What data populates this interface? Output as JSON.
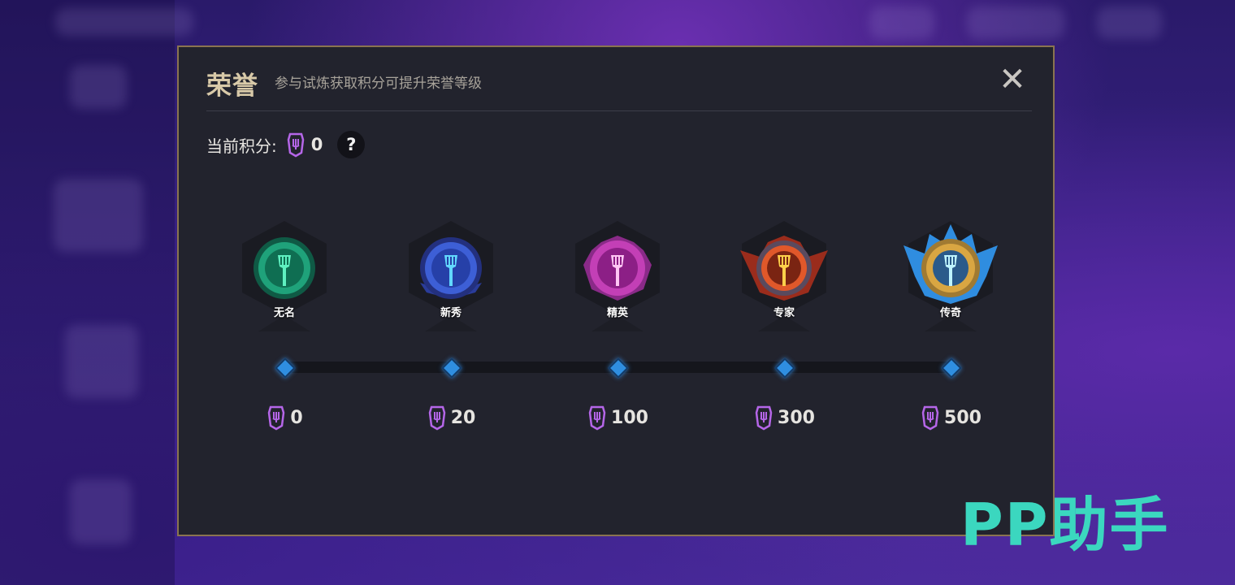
{
  "dialog": {
    "title": "荣誉",
    "subtitle": "参与试炼获取积分可提升荣誉等级",
    "close_label": "✕"
  },
  "score": {
    "label": "当前积分:",
    "value": "0",
    "help_label": "?"
  },
  "tiers": [
    {
      "name": "无名",
      "points": "0",
      "color": "#1fa27a"
    },
    {
      "name": "新秀",
      "points": "20",
      "color": "#3d5fd6"
    },
    {
      "name": "精英",
      "points": "100",
      "color": "#c33fb6"
    },
    {
      "name": "专家",
      "points": "300",
      "color": "#e0582a"
    },
    {
      "name": "传奇",
      "points": "500",
      "color": "#d9a642"
    }
  ],
  "colors": {
    "point_icon": "#b566e8",
    "node": "#2f8ee0",
    "dialog_border": "#8a7450"
  },
  "watermark": "PP助手"
}
